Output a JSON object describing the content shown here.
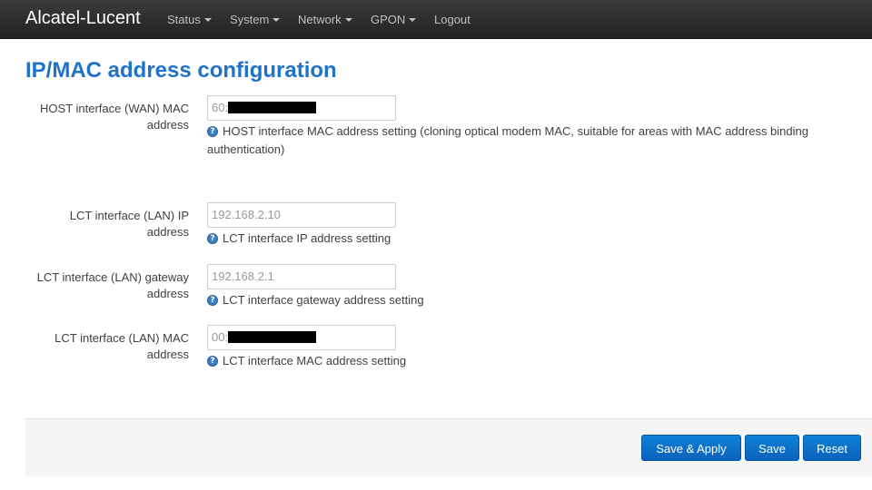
{
  "navbar": {
    "brand": "Alcatel-Lucent",
    "items": [
      {
        "label": "Status",
        "dropdown": true
      },
      {
        "label": "System",
        "dropdown": true
      },
      {
        "label": "Network",
        "dropdown": true
      },
      {
        "label": "GPON",
        "dropdown": true
      },
      {
        "label": "Logout",
        "dropdown": false
      }
    ]
  },
  "page": {
    "title": "IP/MAC address configuration"
  },
  "form": {
    "host_mac": {
      "label_line1": "HOST interface (WAN) MAC",
      "label_line2": "address",
      "value_prefix": "60:",
      "value_redacted": true,
      "hint_line1": "HOST interface MAC address setting (cloning optical modem MAC, suitable for areas with MAC address binding",
      "hint_line2": "authentication)"
    },
    "lct_ip": {
      "label_line1": "LCT interface (LAN) IP",
      "label_line2": "address",
      "value": "192.168.2.10",
      "hint": "LCT interface IP address setting"
    },
    "lct_gateway": {
      "label_line1": "LCT interface (LAN) gateway",
      "label_line2": "address",
      "value": "192.168.2.1",
      "hint": "LCT interface gateway address setting"
    },
    "lct_mac": {
      "label_line1": "LCT interface (LAN) MAC",
      "label_line2": "address",
      "value_prefix": "00:",
      "value_redacted": true,
      "hint": "LCT interface MAC address setting"
    }
  },
  "actions": {
    "save_apply": "Save & Apply",
    "save": "Save",
    "reset": "Reset"
  },
  "icons": {
    "help": "?"
  },
  "colors": {
    "navbar_bg": "#222222",
    "title": "#1f72c9",
    "button": "#0a70c8"
  }
}
